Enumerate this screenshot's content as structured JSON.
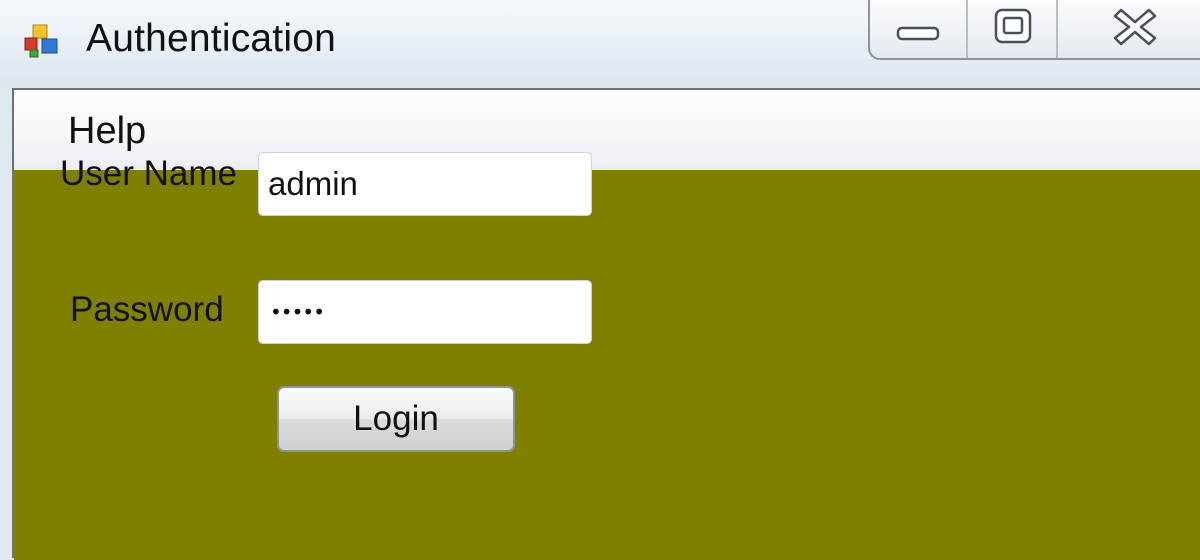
{
  "window": {
    "title": "Authentication",
    "icon": "application-window-icon",
    "controls": [
      "minimize-icon",
      "maximize-icon",
      "close-icon"
    ]
  },
  "menu": {
    "items": [
      {
        "label": "Help"
      }
    ]
  },
  "form": {
    "username": {
      "label": "User Name",
      "value": "admin"
    },
    "password": {
      "label": "Password",
      "value": "•••••"
    },
    "login_label": "Login"
  },
  "colors": {
    "form_background": "#808000",
    "titlebar": "#e7eef6",
    "menubar": "#f4f6f9"
  }
}
